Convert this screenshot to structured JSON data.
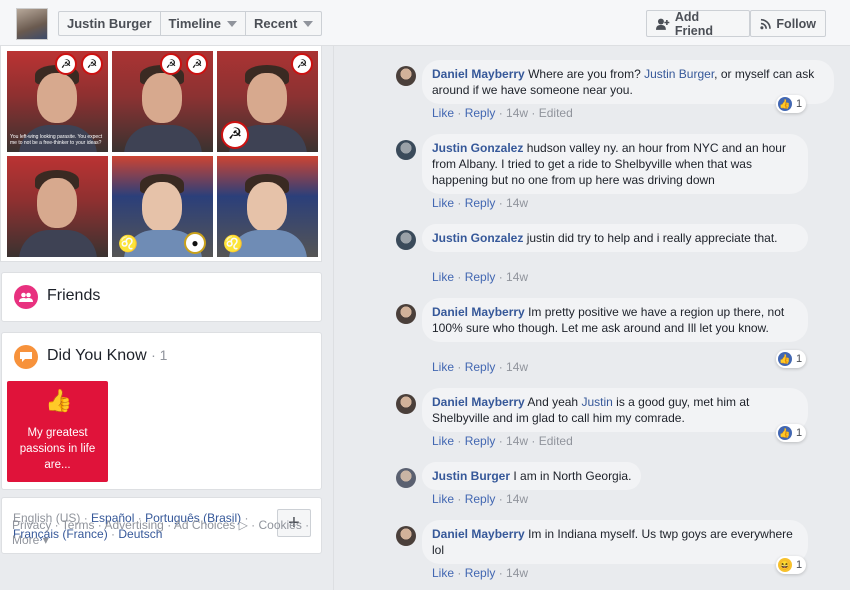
{
  "header": {
    "profile_name": "Justin Burger",
    "timeline_label": "Timeline",
    "recent_label": "Recent",
    "add_friend_label": "Add Friend",
    "follow_label": "Follow"
  },
  "photo_grid": {
    "photos": [
      {
        "caption": "You left-wing looking parasite. You expect me to not be a free-thinker to your ideas?"
      },
      {
        "caption": ""
      },
      {
        "caption": ""
      },
      {
        "caption": ""
      },
      {
        "caption": ""
      },
      {
        "caption": ""
      }
    ]
  },
  "friends": {
    "title": "Friends",
    "icon": "friends-icon"
  },
  "did_you_know": {
    "title": "Did You Know",
    "count": "· 1",
    "card_text": "My greatest passions in life are...",
    "card_icon": "👍"
  },
  "languages": {
    "current": "English (US)",
    "links": [
      "Español",
      "Português (Brasil)",
      "Français (France)",
      "Deutsch"
    ],
    "separator": " · "
  },
  "footer": {
    "links": [
      "Privacy",
      "Terms",
      "Advertising",
      "Ad Choices",
      "Cookies",
      "More"
    ]
  },
  "comments": [
    {
      "author": "Daniel Mayberry",
      "text_before": "Where are you from?",
      "mention": "Justin Burger",
      "text_after": ", or myself can ask around if we have someone near you.",
      "actions": [
        "Like",
        "Reply"
      ],
      "time": "14w",
      "edited": "Edited",
      "reaction": "like",
      "reaction_count": "1"
    },
    {
      "author": "Justin Gonzalez",
      "text_before": "hudson valley ny. an hour from NYC and an hour from Albany. I tried to get a ride to Shelbyville when that was happening but no one from up here was driving down",
      "mention": "",
      "text_after": "",
      "actions": [
        "Like",
        "Reply"
      ],
      "time": "14w",
      "edited": "",
      "reaction": "",
      "reaction_count": ""
    },
    {
      "author": "Justin Gonzalez",
      "text_before": "justin did try to help and i really appreciate that.",
      "mention": "",
      "text_after": "",
      "actions": [
        "Like",
        "Reply"
      ],
      "time": "14w",
      "edited": "",
      "reaction": "",
      "reaction_count": ""
    },
    {
      "author": "Daniel Mayberry",
      "text_before": "Im pretty positive we have a region up there, not 100% sure who though. Let me ask around and Ill let you know.",
      "mention": "",
      "text_after": "",
      "actions": [
        "Like",
        "Reply"
      ],
      "time": "14w",
      "edited": "",
      "reaction": "like",
      "reaction_count": "1"
    },
    {
      "author": "Daniel Mayberry",
      "text_before": "And yeah",
      "mention": "Justin",
      "text_after": "is a good guy, met him at Shelbyville and im glad to call him my comrade.",
      "actions": [
        "Like",
        "Reply"
      ],
      "time": "14w",
      "edited": "Edited",
      "reaction": "like",
      "reaction_count": "1"
    },
    {
      "author": "Justin Burger",
      "text_before": "I am in North Georgia.",
      "mention": "",
      "text_after": "",
      "actions": [
        "Like",
        "Reply"
      ],
      "time": "14w",
      "edited": "",
      "reaction": "",
      "reaction_count": ""
    },
    {
      "author": "Daniel Mayberry",
      "text_before": "Im in Indiana myself. Us twp goys are everywhere lol",
      "mention": "",
      "text_after": "",
      "actions": [
        "Like",
        "Reply"
      ],
      "time": "14w",
      "edited": "",
      "reaction": "haha",
      "reaction_count": "1"
    }
  ]
}
